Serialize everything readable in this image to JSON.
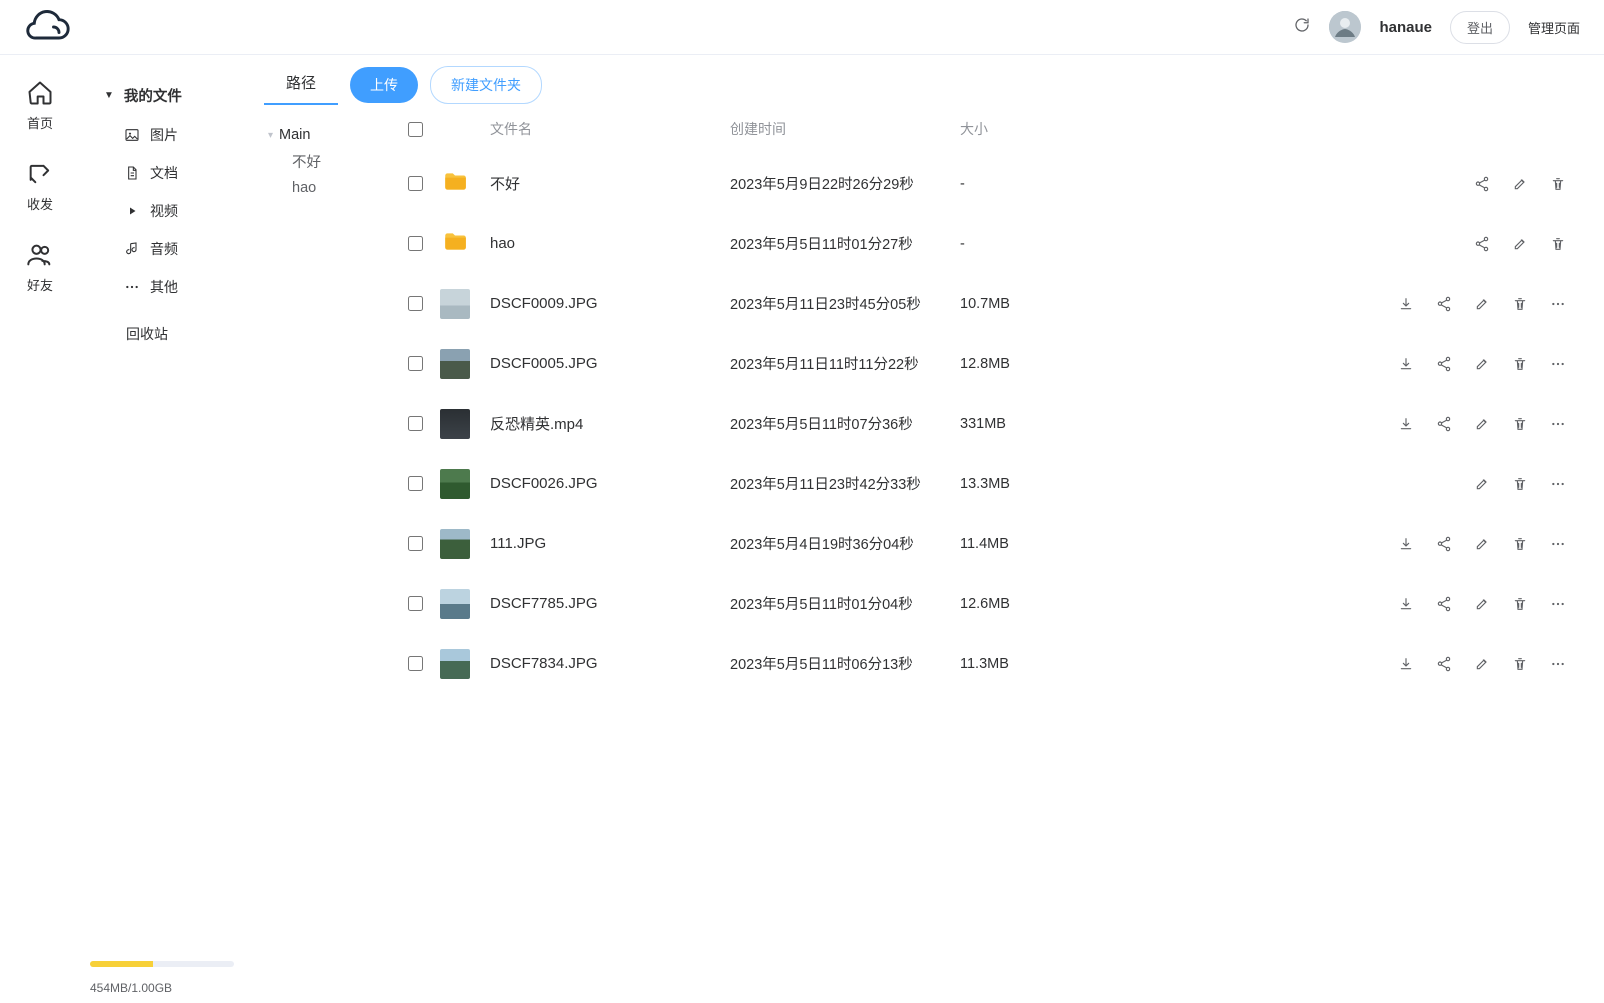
{
  "header": {
    "username": "hanaue",
    "logout": "登出",
    "admin": "管理页面"
  },
  "nav": {
    "home": "首页",
    "transfer": "收发",
    "friends": "好友"
  },
  "sidebar": {
    "my_files": "我的文件",
    "cats": {
      "image": "图片",
      "doc": "文档",
      "video": "视频",
      "audio": "音频",
      "other": "其他"
    },
    "trash": "回收站",
    "storage_text": "454MB/1.00GB",
    "storage_pct": 44
  },
  "topbar": {
    "path_tab": "路径",
    "upload": "上传",
    "new_folder": "新建文件夹"
  },
  "path_tree": {
    "root": "Main",
    "children": [
      "不好",
      "hao"
    ]
  },
  "table": {
    "headers": {
      "name": "文件名",
      "created": "创建时间",
      "size": "大小"
    },
    "rows": [
      {
        "type": "folder",
        "name": "不好",
        "created": "2023年5月9日22时26分29秒",
        "size": "-",
        "actions": [
          "share",
          "edit",
          "delete"
        ]
      },
      {
        "type": "folder",
        "name": "hao",
        "created": "2023年5月5日11时01分27秒",
        "size": "-",
        "actions": [
          "share",
          "edit",
          "delete"
        ]
      },
      {
        "type": "image",
        "thumb": "a",
        "name": "DSCF0009.JPG",
        "created": "2023年5月11日23时45分05秒",
        "size": "10.7MB",
        "actions": [
          "download",
          "share",
          "edit",
          "delete",
          "more"
        ]
      },
      {
        "type": "image",
        "thumb": "b",
        "name": "DSCF0005.JPG",
        "created": "2023年5月11日11时11分22秒",
        "size": "12.8MB",
        "actions": [
          "download",
          "share",
          "edit",
          "delete",
          "more"
        ]
      },
      {
        "type": "video",
        "thumb": "c",
        "name": "反恐精英.mp4",
        "created": "2023年5月5日11时07分36秒",
        "size": "331MB",
        "actions": [
          "download",
          "share",
          "edit",
          "delete",
          "more"
        ]
      },
      {
        "type": "image",
        "thumb": "d",
        "name": "DSCF0026.JPG",
        "created": "2023年5月11日23时42分33秒",
        "size": "13.3MB",
        "actions": [
          "edit",
          "delete",
          "more"
        ]
      },
      {
        "type": "image",
        "thumb": "e",
        "name": "111.JPG",
        "created": "2023年5月4日19时36分04秒",
        "size": "11.4MB",
        "actions": [
          "download",
          "share",
          "edit",
          "delete",
          "more"
        ]
      },
      {
        "type": "image",
        "thumb": "f",
        "name": "DSCF7785.JPG",
        "created": "2023年5月5日11时01分04秒",
        "size": "12.6MB",
        "actions": [
          "download",
          "share",
          "edit",
          "delete",
          "more"
        ]
      },
      {
        "type": "image",
        "thumb": "g",
        "name": "DSCF7834.JPG",
        "created": "2023年5月5日11时06分13秒",
        "size": "11.3MB",
        "actions": [
          "download",
          "share",
          "edit",
          "delete",
          "more"
        ]
      }
    ]
  }
}
